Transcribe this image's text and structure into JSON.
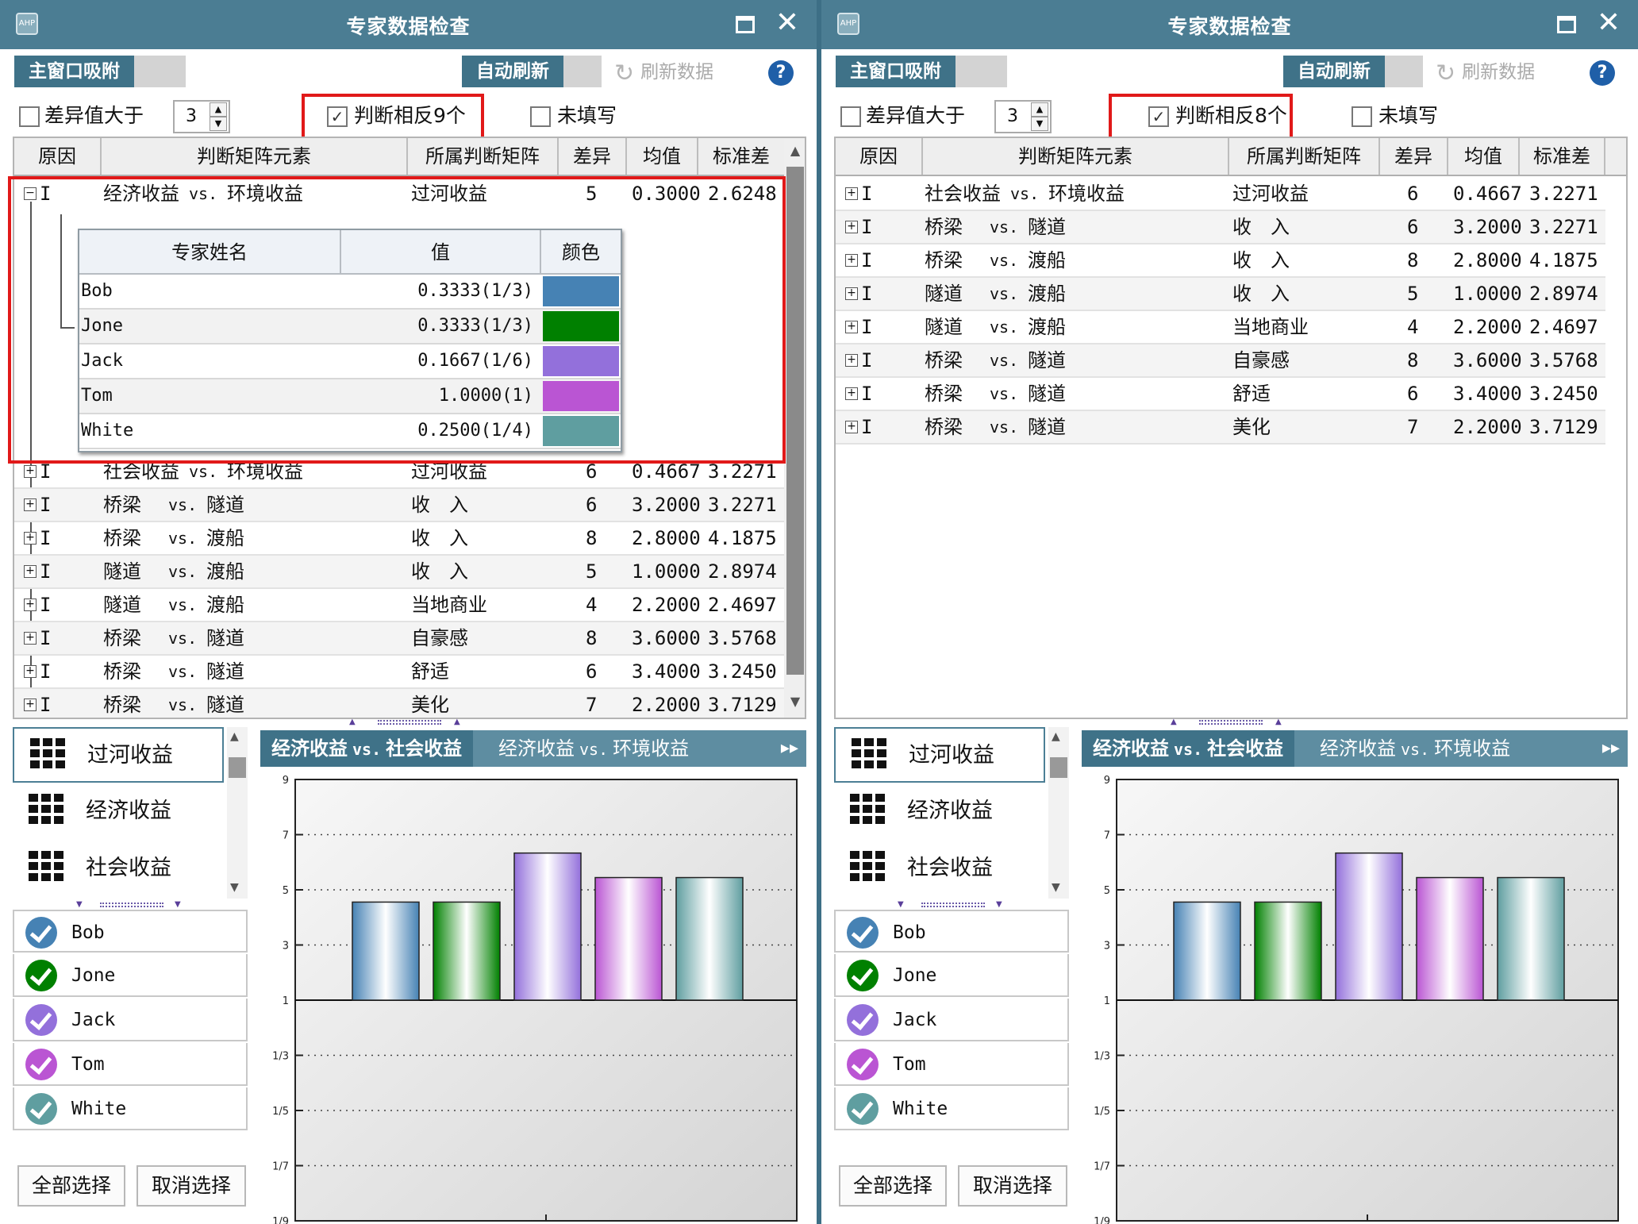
{
  "window": {
    "title": "专家数据检查",
    "app_icon": "AHP"
  },
  "toolbar": {
    "attach_label": "主窗口吸附",
    "auto_refresh_label": "自动刷新",
    "refresh_label": "刷新数据",
    "help_label": "?"
  },
  "columns": {
    "reason": "原因",
    "element": "判断矩阵元素",
    "matrix": "所属判断矩阵",
    "diff": "差异",
    "mean": "均值",
    "std": "标准差"
  },
  "expert_columns": {
    "name": "专家姓名",
    "value": "值",
    "color": "颜色"
  },
  "categories": [
    "过河收益",
    "经济收益",
    "社会收益"
  ],
  "experts": [
    {
      "name": "Bob",
      "color": "#4682b4"
    },
    {
      "name": "Jone",
      "color": "#008000"
    },
    {
      "name": "Jack",
      "color": "#9370db"
    },
    {
      "name": "Tom",
      "color": "#ba55d3"
    },
    {
      "name": "White",
      "color": "#5f9ea0"
    }
  ],
  "buttons": {
    "select_all": "全部选择",
    "deselect": "取消选择"
  },
  "chart_tabs": [
    {
      "a": "经济收益",
      "vs": "vs.",
      "b": "社会收益",
      "active": true
    },
    {
      "a": "经济收益",
      "vs": "vs.",
      "b": "环境收益",
      "active": false
    }
  ],
  "chart_data": [
    {
      "type": "bar",
      "categories": [
        "Bob",
        "Jone",
        "Jack",
        "Tom",
        "White"
      ],
      "values": [
        4,
        4,
        6,
        5,
        5
      ],
      "colors": [
        "#4682b4",
        "#008000",
        "#9370db",
        "#ba55d3",
        "#5f9ea0"
      ],
      "title": "",
      "xlabel": "",
      "ylabel": "",
      "ylim": [
        -9,
        9
      ],
      "yticks": [
        "9",
        "7",
        "5",
        "3",
        "1",
        "1/3",
        "1/5",
        "1/7",
        "1/9"
      ],
      "grid": true
    },
    {
      "type": "bar",
      "categories": [
        "Bob",
        "Jone",
        "Jack",
        "Tom",
        "White"
      ],
      "values": [
        4,
        4,
        6,
        5,
        5
      ],
      "colors": [
        "#4682b4",
        "#008000",
        "#9370db",
        "#ba55d3",
        "#5f9ea0"
      ],
      "title": "",
      "xlabel": "",
      "ylabel": "",
      "ylim": [
        -9,
        9
      ],
      "yticks": [
        "9",
        "7",
        "5",
        "3",
        "1",
        "1/3",
        "1/5",
        "1/7",
        "1/9"
      ],
      "grid": true
    }
  ],
  "left": {
    "diff_label": "差异值大于",
    "spin_value": "3",
    "opposite_label": "判断相反9个",
    "opposite_checked": "✓",
    "unfilled_label": "未填写",
    "expanded_row": {
      "reason": "I",
      "element_a": "经济收益",
      "vs": "vs.",
      "element_b": "环境收益",
      "matrix": "过河收益",
      "diff": "5",
      "mean": "0.3000",
      "std": "2.6248",
      "details": [
        {
          "name": "Bob",
          "value": "0.3333(1/3)"
        },
        {
          "name": "Jone",
          "value": "0.3333(1/3)"
        },
        {
          "name": "Jack",
          "value": "0.1667(1/6)"
        },
        {
          "name": "Tom",
          "value": "1.0000(1)"
        },
        {
          "name": "White",
          "value": "0.2500(1/4)"
        }
      ]
    },
    "rows": [
      {
        "reason": "I",
        "element_a": "社会收益",
        "vs": "vs.",
        "element_b": "环境收益",
        "matrix": "过河收益",
        "diff": "6",
        "mean": "0.4667",
        "std": "3.2271"
      },
      {
        "reason": "I",
        "element_a": "桥梁",
        "vs": "vs.",
        "element_b": "隧道",
        "matrix": "收　入",
        "diff": "6",
        "mean": "3.2000",
        "std": "3.2271"
      },
      {
        "reason": "I",
        "element_a": "桥梁",
        "vs": "vs.",
        "element_b": "渡船",
        "matrix": "收　入",
        "diff": "8",
        "mean": "2.8000",
        "std": "4.1875"
      },
      {
        "reason": "I",
        "element_a": "隧道",
        "vs": "vs.",
        "element_b": "渡船",
        "matrix": "收　入",
        "diff": "5",
        "mean": "1.0000",
        "std": "2.8974"
      },
      {
        "reason": "I",
        "element_a": "隧道",
        "vs": "vs.",
        "element_b": "渡船",
        "matrix": "当地商业",
        "diff": "4",
        "mean": "2.2000",
        "std": "2.4697"
      },
      {
        "reason": "I",
        "element_a": "桥梁",
        "vs": "vs.",
        "element_b": "隧道",
        "matrix": "自豪感",
        "diff": "8",
        "mean": "3.6000",
        "std": "3.5768"
      },
      {
        "reason": "I",
        "element_a": "桥梁",
        "vs": "vs.",
        "element_b": "隧道",
        "matrix": "舒适",
        "diff": "6",
        "mean": "3.4000",
        "std": "3.2450"
      },
      {
        "reason": "I",
        "element_a": "桥梁",
        "vs": "vs.",
        "element_b": "隧道",
        "matrix": "美化",
        "diff": "7",
        "mean": "2.2000",
        "std": "3.7129"
      }
    ]
  },
  "right": {
    "diff_label": "差异值大于",
    "spin_value": "3",
    "opposite_label": "判断相反8个",
    "opposite_checked": "✓",
    "unfilled_label": "未填写",
    "rows": [
      {
        "reason": "I",
        "element_a": "社会收益",
        "vs": "vs.",
        "element_b": "环境收益",
        "matrix": "过河收益",
        "diff": "6",
        "mean": "0.4667",
        "std": "3.2271"
      },
      {
        "reason": "I",
        "element_a": "桥梁",
        "vs": "vs.",
        "element_b": "隧道",
        "matrix": "收　入",
        "diff": "6",
        "mean": "3.2000",
        "std": "3.2271"
      },
      {
        "reason": "I",
        "element_a": "桥梁",
        "vs": "vs.",
        "element_b": "渡船",
        "matrix": "收　入",
        "diff": "8",
        "mean": "2.8000",
        "std": "4.1875"
      },
      {
        "reason": "I",
        "element_a": "隧道",
        "vs": "vs.",
        "element_b": "渡船",
        "matrix": "收　入",
        "diff": "5",
        "mean": "1.0000",
        "std": "2.8974"
      },
      {
        "reason": "I",
        "element_a": "隧道",
        "vs": "vs.",
        "element_b": "渡船",
        "matrix": "当地商业",
        "diff": "4",
        "mean": "2.2000",
        "std": "2.4697"
      },
      {
        "reason": "I",
        "element_a": "桥梁",
        "vs": "vs.",
        "element_b": "隧道",
        "matrix": "自豪感",
        "diff": "8",
        "mean": "3.6000",
        "std": "3.5768"
      },
      {
        "reason": "I",
        "element_a": "桥梁",
        "vs": "vs.",
        "element_b": "隧道",
        "matrix": "舒适",
        "diff": "6",
        "mean": "3.4000",
        "std": "3.2450"
      },
      {
        "reason": "I",
        "element_a": "桥梁",
        "vs": "vs.",
        "element_b": "隧道",
        "matrix": "美化",
        "diff": "7",
        "mean": "2.2000",
        "std": "3.7129"
      }
    ]
  }
}
